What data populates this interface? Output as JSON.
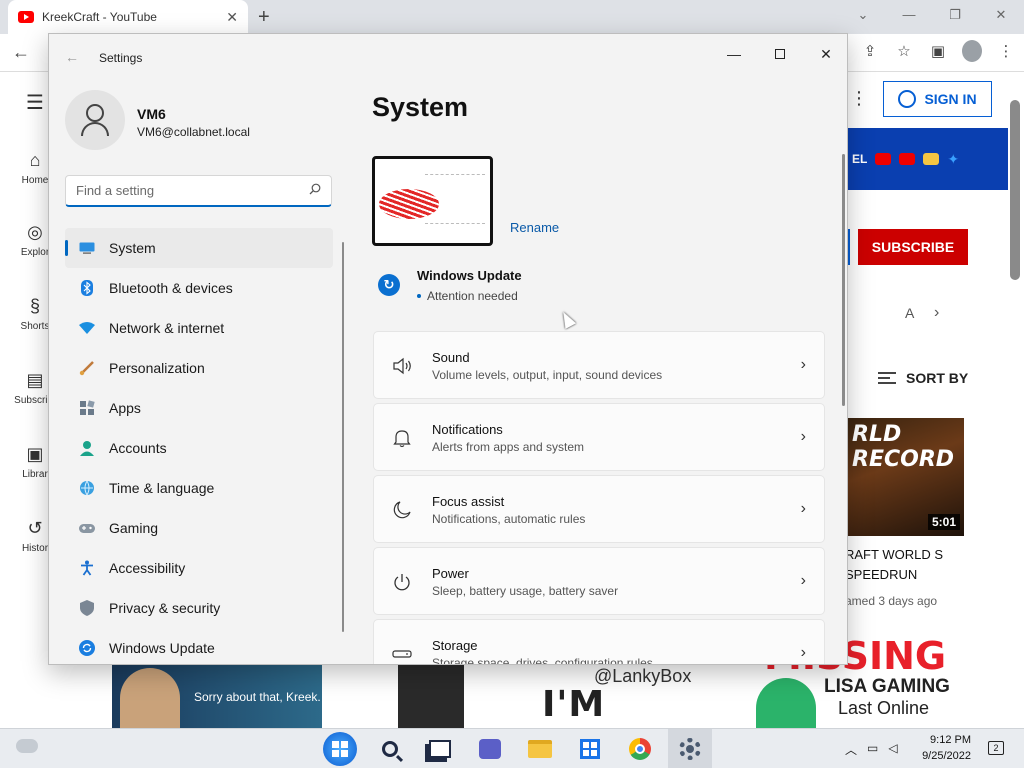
{
  "browser": {
    "tab_title": "KreekCraft - YouTube",
    "tab_close": "✕",
    "new_tab": "+"
  },
  "youtube": {
    "nav": [
      {
        "label": "Home",
        "icon": "home-icon",
        "glyph": "⌂"
      },
      {
        "label": "Explor",
        "icon": "compass-icon",
        "glyph": "◎"
      },
      {
        "label": "Shorts",
        "icon": "shorts-icon",
        "glyph": "§"
      },
      {
        "label": "Subscript",
        "icon": "subscriptions-icon",
        "glyph": "▤"
      },
      {
        "label": "Librar",
        "icon": "library-icon",
        "glyph": "▣"
      },
      {
        "label": "Histor",
        "icon": "history-icon",
        "glyph": "↺"
      }
    ],
    "sign_in": "SIGN IN",
    "banner_text": "EL",
    "subscribe": "SUBSCRIBE",
    "chip_partial": "A",
    "sort_by": "SORT BY",
    "video": {
      "thumb_text": "RLD RECORD",
      "duration": "5:01",
      "title": "RAFT WORLD S SPEEDRUN",
      "meta": "amed 3 days ago"
    },
    "bottom_thumbs": {
      "caption1": "Sorry about that, Kreek.",
      "handle": "@LankyBox",
      "sorry": "I'M SORRY",
      "missing": "MISSING",
      "lisa1": "LISA GAMING",
      "lisa2": "Last Online"
    }
  },
  "settings": {
    "app_title": "Settings",
    "user_name": "VM6",
    "user_email": "VM6@collabnet.local",
    "search_placeholder": "Find a setting",
    "nav": [
      {
        "label": "System",
        "icon": "system-icon",
        "active": true
      },
      {
        "label": "Bluetooth & devices",
        "icon": "bluetooth-icon"
      },
      {
        "label": "Network & internet",
        "icon": "network-icon"
      },
      {
        "label": "Personalization",
        "icon": "personalization-icon"
      },
      {
        "label": "Apps",
        "icon": "apps-icon"
      },
      {
        "label": "Accounts",
        "icon": "accounts-icon"
      },
      {
        "label": "Time & language",
        "icon": "time-language-icon"
      },
      {
        "label": "Gaming",
        "icon": "gaming-icon"
      },
      {
        "label": "Accessibility",
        "icon": "accessibility-icon"
      },
      {
        "label": "Privacy & security",
        "icon": "privacy-icon"
      },
      {
        "label": "Windows Update",
        "icon": "windows-update-icon"
      }
    ],
    "page_title": "System",
    "rename": "Rename",
    "update_title": "Windows Update",
    "update_status": "Attention needed",
    "cards": [
      {
        "title": "Sound",
        "subtitle": "Volume levels, output, input, sound devices",
        "icon": "speaker-icon"
      },
      {
        "title": "Notifications",
        "subtitle": "Alerts from apps and system",
        "icon": "bell-icon"
      },
      {
        "title": "Focus assist",
        "subtitle": "Notifications, automatic rules",
        "icon": "moon-icon"
      },
      {
        "title": "Power",
        "subtitle": "Sleep, battery usage, battery saver",
        "icon": "power-icon"
      },
      {
        "title": "Storage",
        "subtitle": "Storage space, drives, configuration rules",
        "icon": "storage-icon"
      }
    ]
  },
  "taskbar": {
    "time": "9:12 PM",
    "date": "9/25/2022",
    "notifications": "2"
  },
  "colors": {
    "accent": "#0067c0",
    "youtube_red": "#cc0000",
    "signin_blue": "#065fd4"
  }
}
